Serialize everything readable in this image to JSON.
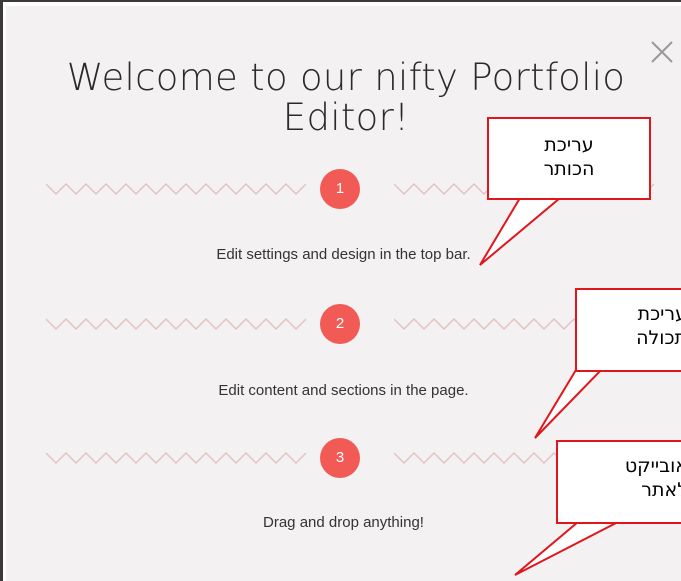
{
  "dialog": {
    "title": "Welcome to our nifty Portfolio Editor!",
    "close_icon": "close-x-icon",
    "colors": {
      "background": "#f3f1f1",
      "accent": "#f25a55",
      "zigzag": "#e2c1bf",
      "callout_border": "#e0161c"
    }
  },
  "steps": [
    {
      "number": "1",
      "caption": "Edit settings and design in the top bar."
    },
    {
      "number": "2",
      "caption": "Edit content and sections in the page."
    },
    {
      "number": "3",
      "caption": "Drag and drop anything!"
    }
  ],
  "callouts": [
    {
      "line1": "עריכת",
      "line2": "הכותר"
    },
    {
      "line1": "עריכת",
      "line2": "תכולה"
    },
    {
      "line1": "אובייקט",
      "line2": "לאתר"
    }
  ]
}
